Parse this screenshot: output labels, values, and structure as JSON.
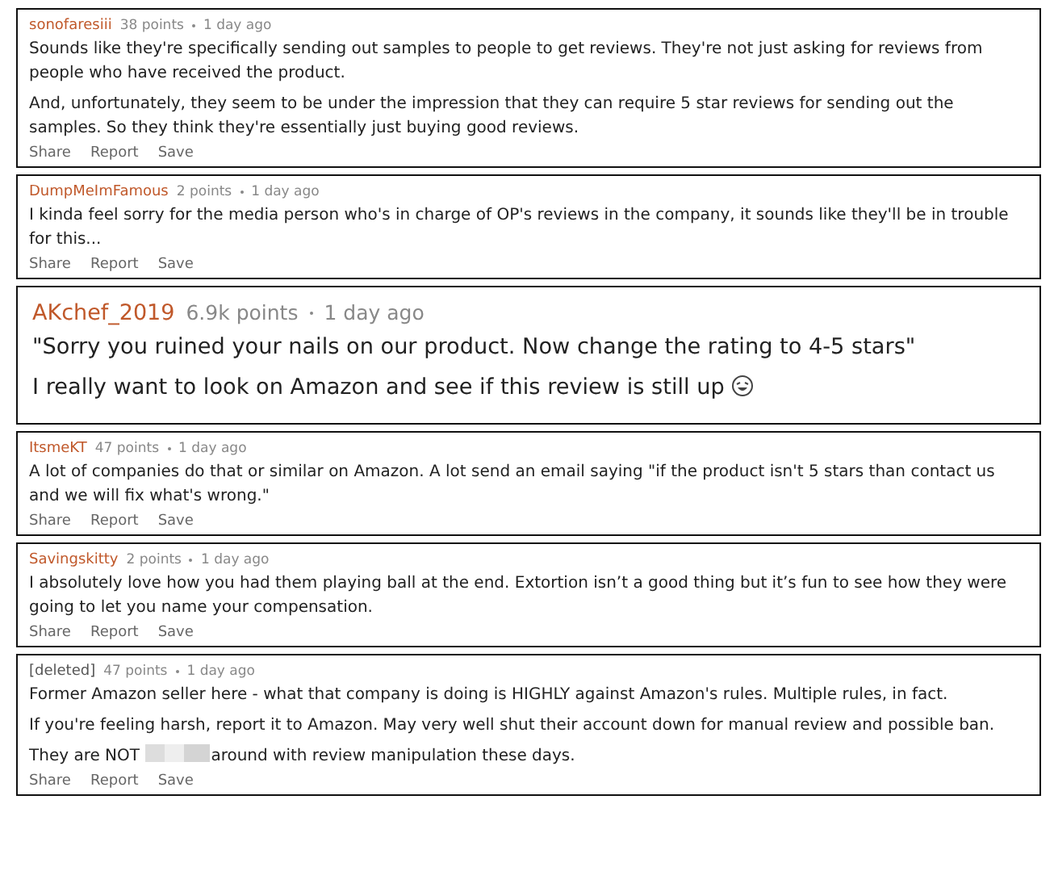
{
  "comments": [
    {
      "kind": "normal",
      "author": "sonofaresiii",
      "deleted": false,
      "points": "38 points",
      "time": "1 day ago",
      "paragraphs": [
        [
          {
            "kind": "text",
            "text": "Sounds like they're specifically sending out samples to people to get reviews. They're not just asking for reviews from people who have received the product."
          }
        ],
        [
          {
            "kind": "text",
            "text": "And, unfortunately, they seem to be under the impression that they can require 5 star reviews for sending out the samples. So they think they're essentially just buying good reviews."
          }
        ]
      ],
      "actions": [
        "Share",
        "Report",
        "Save"
      ]
    },
    {
      "kind": "normal",
      "author": "DumpMeImFamous",
      "deleted": false,
      "points": "2 points",
      "time": "1 day ago",
      "paragraphs": [
        [
          {
            "kind": "text",
            "text": "I kinda feel sorry for the media person who's in charge of OP's reviews in the company, it sounds like they'll be in trouble for this..."
          }
        ]
      ],
      "actions": [
        "Share",
        "Report",
        "Save"
      ]
    },
    {
      "kind": "large",
      "author": "AKchef_2019",
      "deleted": false,
      "points": "6.9k points",
      "time": "1 day ago",
      "paragraphs": [
        [
          {
            "kind": "text",
            "text": "\"Sorry you ruined your nails on our product. Now change the rating to 4-5 stars\""
          }
        ],
        [
          {
            "kind": "text",
            "text": "I really want to look on Amazon and see if this review is still up "
          },
          {
            "kind": "emoji"
          }
        ]
      ]
    },
    {
      "kind": "normal",
      "author": "ItsmeKT",
      "deleted": false,
      "points": "47 points",
      "time": "1 day ago",
      "paragraphs": [
        [
          {
            "kind": "text",
            "text": "A lot of companies do that or similar on Amazon. A lot send an email saying \"if the product isn't 5 stars than contact us and we will fix what's wrong.\""
          }
        ]
      ],
      "actions": [
        "Share",
        "Report",
        "Save"
      ]
    },
    {
      "kind": "normal",
      "author": "Savingskitty",
      "deleted": false,
      "points": "2 points",
      "time": "1 day ago",
      "paragraphs": [
        [
          {
            "kind": "text",
            "text": "I absolutely love how you had them playing ball at the end. Extortion isn’t a good thing but it’s fun to see how they were going to let you name your compensation."
          }
        ]
      ],
      "actions": [
        "Share",
        "Report",
        "Save"
      ]
    },
    {
      "kind": "normal",
      "author": "[deleted]",
      "deleted": true,
      "points": "47 points",
      "time": "1 day ago",
      "paragraphs": [
        [
          {
            "kind": "text",
            "text": "Former Amazon seller here - what that company is doing is HIGHLY against Amazon's rules. Multiple rules, in fact."
          }
        ],
        [
          {
            "kind": "text",
            "text": "If you're feeling harsh, report it to Amazon. May very well shut their account down for manual review and possible ban."
          }
        ],
        [
          {
            "kind": "text",
            "text": "They are NOT "
          },
          {
            "kind": "censored"
          },
          {
            "kind": "text",
            "text": "around with review manipulation these days."
          }
        ]
      ],
      "actions": [
        "Share",
        "Report",
        "Save"
      ]
    }
  ]
}
